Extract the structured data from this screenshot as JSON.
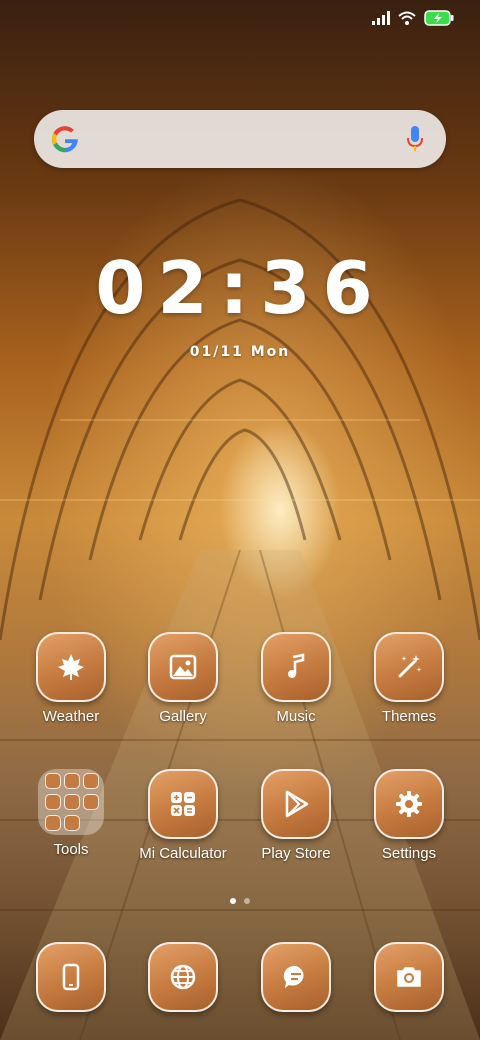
{
  "clock": {
    "time": "02:36",
    "date": "01/11 Mon"
  },
  "home_row_1": [
    {
      "label": "Weather",
      "icon": "maple-leaf-icon"
    },
    {
      "label": "Gallery",
      "icon": "image-icon"
    },
    {
      "label": "Music",
      "icon": "music-note-icon"
    },
    {
      "label": "Themes",
      "icon": "magic-wand-icon"
    }
  ],
  "home_row_2": [
    {
      "label": "Tools",
      "icon": "folder"
    },
    {
      "label": "Mi Calculator",
      "icon": "calculator-icon"
    },
    {
      "label": "Play Store",
      "icon": "play-store-icon"
    },
    {
      "label": "Settings",
      "icon": "gear-icon"
    }
  ],
  "dock": [
    {
      "icon": "phone-icon"
    },
    {
      "icon": "globe-icon"
    },
    {
      "icon": "message-icon"
    },
    {
      "icon": "camera-icon"
    }
  ],
  "pages": {
    "count": 2,
    "active": 1
  },
  "colors": {
    "icon_fill": "#c57a3f",
    "label": "#ffffff",
    "battery": "#3ddc4a"
  }
}
